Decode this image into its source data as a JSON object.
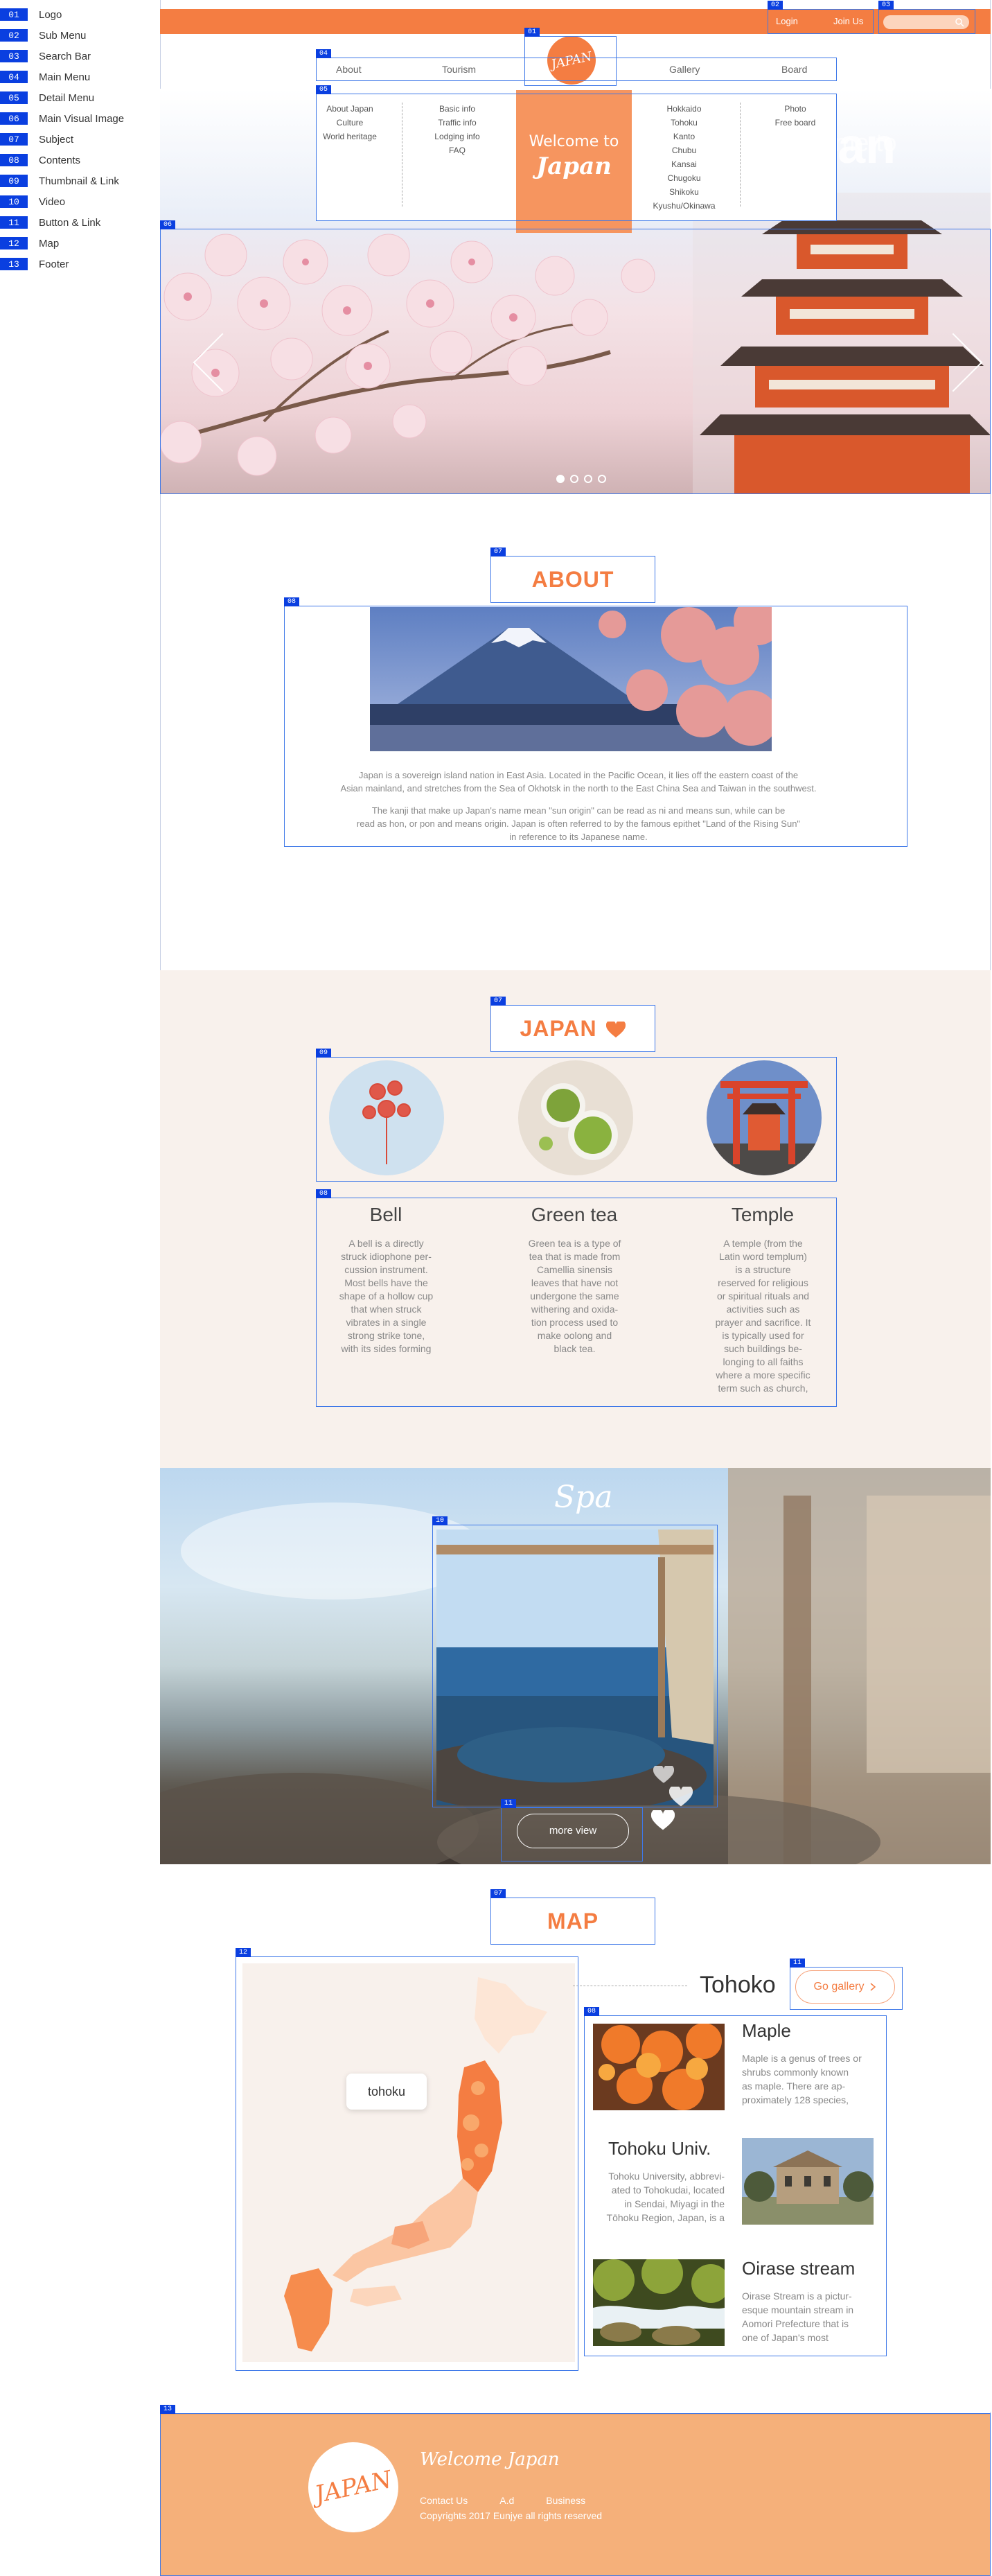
{
  "legend": [
    {
      "num": "01",
      "label": "Logo"
    },
    {
      "num": "02",
      "label": "Sub Menu"
    },
    {
      "num": "03",
      "label": "Search Bar"
    },
    {
      "num": "04",
      "label": "Main Menu"
    },
    {
      "num": "05",
      "label": "Detail Menu"
    },
    {
      "num": "06",
      "label": "Main Visual Image"
    },
    {
      "num": "07",
      "label": "Subject"
    },
    {
      "num": "08",
      "label": "Contents"
    },
    {
      "num": "09",
      "label": "Thumbnail & Link"
    },
    {
      "num": "10",
      "label": "Video"
    },
    {
      "num": "11",
      "label": "Button & Link"
    },
    {
      "num": "12",
      "label": "Map"
    },
    {
      "num": "13",
      "label": "Footer"
    }
  ],
  "submenu": {
    "login": "Login",
    "join": "Join Us"
  },
  "logo": {
    "text": "JAPAN"
  },
  "mainmenu": {
    "about": "About",
    "tourism": "Tourism",
    "gallery": "Gallery",
    "board": "Board"
  },
  "detailmenu": {
    "col1": [
      "About Japan",
      "Culture",
      "World heritage"
    ],
    "col2": [
      "Basic info",
      "Traffic info",
      "Lodging info",
      "FAQ"
    ],
    "col3": [
      "Hokkaido",
      "Tohoku",
      "Kanto",
      "Chubu",
      "Kansai",
      "Chugoku",
      "Shikoku",
      "Kyushu/Okinawa"
    ],
    "col4": [
      "Photo",
      "Free board"
    ]
  },
  "hero": {
    "welcome_line1": "Welcome to",
    "welcome_line2": "Japan",
    "big_text": "Japan",
    "small_text": "Welcome to"
  },
  "about": {
    "subject": "ABOUT JAPAN",
    "para1_line1": "Japan is a sovereign island nation in East Asia. Located in the Pacific Ocean, it lies off the eastern coast of the",
    "para1_line2": "Asian mainland, and stretches from the Sea of Okhotsk in the north to the East China Sea and Taiwan in the southwest.",
    "para2_line1": "The kanji that make up Japan's name mean \"sun origin\"      can be read as ni and means sun, while      can be",
    "para2_line2": "read as hon, or pon and means origin. Japan is often referred to by the famous epithet \"Land of the Rising Sun\"",
    "para2_line3": "in reference to its Japanese name."
  },
  "japan": {
    "subject": "JAPAN",
    "cards": [
      {
        "title": "Bell",
        "lines": [
          "A bell is a directly",
          "struck idiophone per-",
          "cussion instrument.",
          "Most bells have the",
          "shape of a hollow cup",
          "that when struck",
          "vibrates in a single",
          "strong strike tone,",
          "with its sides forming"
        ]
      },
      {
        "title": "Green tea",
        "lines": [
          "Green tea is a type of",
          "tea that is made from",
          "Camellia sinensis",
          "leaves that have not",
          "undergone the same",
          "withering and oxida-",
          "tion process used to",
          "make oolong and",
          "black tea."
        ]
      },
      {
        "title": "Temple",
        "lines": [
          "A temple (from the",
          "Latin word templum)",
          "is a structure",
          "reserved for religious",
          "or spiritual rituals and",
          "activities such as",
          "prayer and sacrifice. It",
          "is typically used for",
          "such buildings be-",
          "longing to all faiths",
          "where a more specific",
          "term such as church,"
        ]
      }
    ]
  },
  "video": {
    "title": "Spa",
    "button": "more view"
  },
  "map": {
    "subject": "MAP",
    "tooltip": "tohoku",
    "region": "Tohoko",
    "gallery_button": "Go gallery",
    "items": [
      {
        "title": "Maple",
        "lines": [
          "Maple is a genus of trees or",
          "shrubs commonly known",
          "as maple. There are ap-",
          "proximately 128 species,"
        ]
      },
      {
        "title": "Tohoku Univ.",
        "lines": [
          "Tohoku University, abbrevi-",
          "ated to Tohokudai, located",
          "in Sendai, Miyagi in the",
          "Tōhoku Region, Japan, is a"
        ]
      },
      {
        "title": "Oirase stream",
        "lines": [
          "Oirase Stream is a pictur-",
          "esque mountain stream in",
          "Aomori Prefecture that is",
          "one of Japan's most"
        ]
      }
    ]
  },
  "footer": {
    "logo": "JAPAN",
    "welcome": "Welcome Japan",
    "links": [
      "Contact Us",
      "A.d",
      "Business"
    ],
    "copyright": "Copyrights 2017 Eunjye all rights reserved"
  },
  "colors": {
    "accent": "#f47d42",
    "annotation": "#3e78e8",
    "legend_badge": "#0a3fe0",
    "section_bg": "#f8f1ec",
    "footer_bg": "#f5b07a"
  }
}
